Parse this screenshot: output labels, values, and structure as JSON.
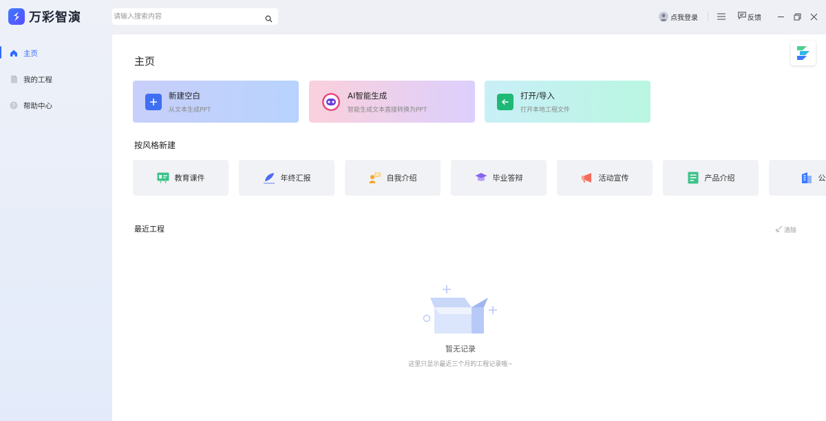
{
  "app": {
    "name": "万彩智演",
    "logo_icon": "app-logo-icon"
  },
  "sidebar": {
    "items": [
      {
        "label": "主页",
        "icon": "home-icon",
        "active": true
      },
      {
        "label": "我的工程",
        "icon": "document-icon",
        "active": false
      },
      {
        "label": "帮助中心",
        "icon": "help-icon",
        "active": false
      }
    ]
  },
  "topbar": {
    "search_placeholder": "请输入搜索内容",
    "login_label": "点我登录",
    "feedback_label": "反馈"
  },
  "main": {
    "title": "主页",
    "actions": [
      {
        "title": "新建空白",
        "subtitle": "从文本生成PPT"
      },
      {
        "title": "AI智能生成",
        "subtitle": "智能生成文本直接转换为PPT"
      },
      {
        "title": "打开/导入",
        "subtitle": "打开本地工程文件"
      }
    ],
    "style_section_title": "按风格新建",
    "styles": [
      {
        "label": "教育课件",
        "icon": "education-icon",
        "color": "#3cc28a"
      },
      {
        "label": "年终汇报",
        "icon": "pen-icon",
        "color": "#4e6cf0"
      },
      {
        "label": "自我介绍",
        "icon": "person-icon",
        "color": "#f5a623"
      },
      {
        "label": "毕业答辩",
        "icon": "graduation-cap-icon",
        "color": "#8a63f0"
      },
      {
        "label": "活动宣传",
        "icon": "megaphone-icon",
        "color": "#f26d5b"
      },
      {
        "label": "产品介绍",
        "icon": "product-doc-icon",
        "color": "#3cc28a"
      },
      {
        "label": "公司",
        "icon": "company-building-icon",
        "color": "#3a7bff"
      }
    ],
    "recent_title": "最近工程",
    "clear_label": "清除",
    "empty_title": "暂无记录",
    "empty_subtitle": "这里只显示最近三个月的工程记录哦~"
  },
  "colors": {
    "accent": "#2f6bff"
  }
}
